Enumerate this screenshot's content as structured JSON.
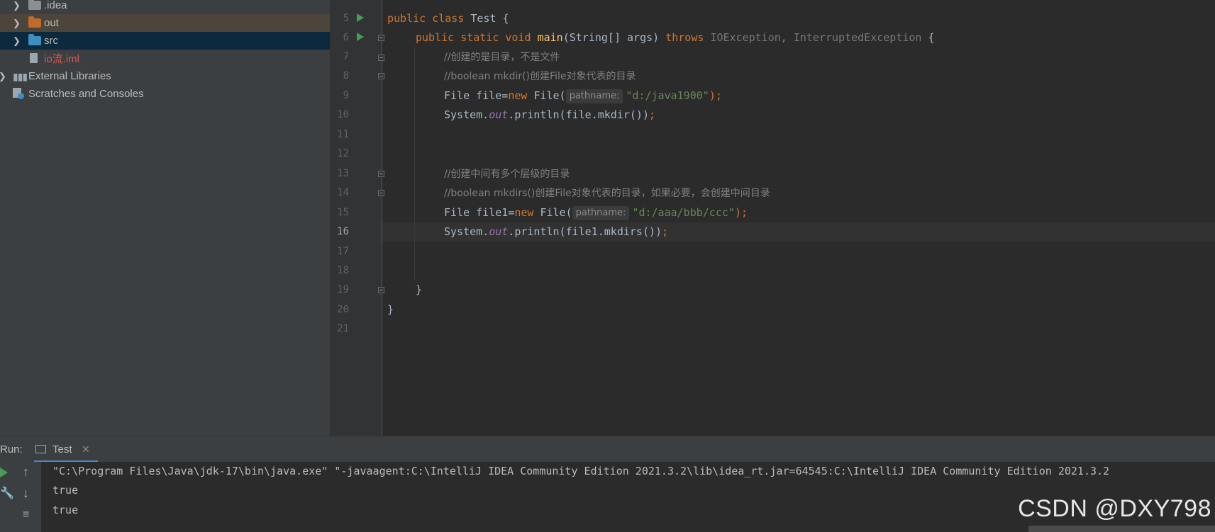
{
  "project_tree": {
    "items": [
      {
        "label": ".idea",
        "type": "folder",
        "color": "#8a8f94"
      },
      {
        "label": "out",
        "type": "folder",
        "color": "#c06a2c"
      },
      {
        "label": "src",
        "type": "folder",
        "color": "#3d8fbf"
      },
      {
        "label": "io流.iml",
        "type": "file",
        "color": "#d9534f"
      },
      {
        "label": "External Libraries",
        "type": "libraries"
      },
      {
        "label": "Scratches and Consoles",
        "type": "scratches"
      }
    ]
  },
  "editor": {
    "line_numbers": [
      "5",
      "6",
      "7",
      "8",
      "9",
      "10",
      "11",
      "12",
      "13",
      "14",
      "15",
      "16",
      "17",
      "18",
      "19",
      "20",
      "21"
    ],
    "current_line": "16",
    "code": {
      "l5_kw1": "public",
      "l5_kw2": "class",
      "l5_rest": "Test {",
      "l6_kw": "public static void",
      "l6_fn": "main",
      "l6_params": "(String[] args)",
      "l6_throws": "throws",
      "l6_ex1": "IOException",
      "l6_comma": ",",
      "l6_ex2": "InterruptedException",
      "l6_brace": "{",
      "l7": "//创建的是目录，不是文件",
      "l8": "//boolean mkdir()创建File对象代表的目录",
      "l9_a": "File file=",
      "l9_new": "new",
      "l9_b": "File(",
      "l9_hint": "pathname:",
      "l9_str": "\"d:/java1900\"",
      "l9_end": ");",
      "l10_a": "System.",
      "l10_out": "out",
      "l10_b": ".println(file.mkdir())",
      "l10_end": ";",
      "l13": "//创建中间有多个层级的目录",
      "l14": "//boolean mkdirs()创建File对象代表的目录，如果必要，会创建中间目录",
      "l15_a": "File file1=",
      "l15_new": "new",
      "l15_b": "File(",
      "l15_hint": "pathname:",
      "l15_str": "\"d:/aaa/bbb/ccc\"",
      "l15_end": ");",
      "l16_a": "System.",
      "l16_out": "out",
      "l16_b": ".println(file1.mkdirs())",
      "l16_end": ";",
      "l19": "}",
      "l20": "}"
    }
  },
  "run_panel": {
    "label": "Run:",
    "tab_label": "Test",
    "close_glyph": "✕",
    "output": [
      "\"C:\\Program Files\\Java\\jdk-17\\bin\\java.exe\" \"-javaagent:C:\\IntelliJ IDEA Community Edition 2021.3.2\\lib\\idea_rt.jar=64545:C:\\IntelliJ IDEA Community Edition 2021.3.2",
      "true",
      "true"
    ]
  },
  "watermark": "CSDN @DXY798",
  "colors": {
    "keyword": "#cc7832",
    "string": "#6a8759",
    "comment": "#808080",
    "method": "#ffc66d",
    "field": "#9876aa",
    "run_icon": "#499c54"
  }
}
